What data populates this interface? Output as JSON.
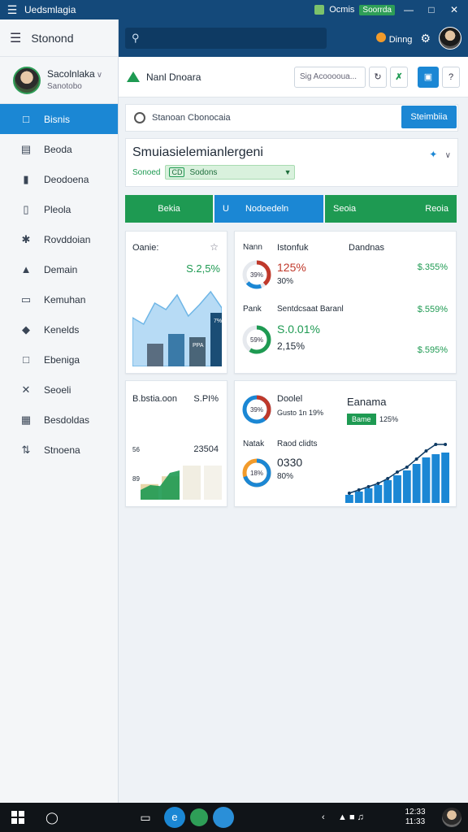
{
  "titlebar": {
    "title": "Uedsmlagia",
    "right_label": "Ocmis",
    "chip": "Soorrda",
    "controls": [
      "—",
      "□",
      "✕"
    ]
  },
  "sidebar": {
    "header": "Stonond",
    "user": {
      "name": "Sacolnlaka",
      "sub": "Sanotobo"
    },
    "items": [
      {
        "label": "Bisnis",
        "icon": "chart-icon",
        "active": true
      },
      {
        "label": "Beoda",
        "icon": "monitor-icon"
      },
      {
        "label": "Deodoena",
        "icon": "lock-icon"
      },
      {
        "label": "Pleola",
        "icon": "document-icon"
      },
      {
        "label": "Rovddoian",
        "icon": "wrench-icon"
      },
      {
        "label": "Demain",
        "icon": "bag-icon"
      },
      {
        "label": "Kemuhan",
        "icon": "folder-icon"
      },
      {
        "label": "Kenelds",
        "icon": "drop-icon"
      },
      {
        "label": "Ebeniga",
        "icon": "copy-icon"
      },
      {
        "label": "Seoeli",
        "icon": "tools-icon"
      },
      {
        "label": "Besdoldas",
        "icon": "calendar-icon"
      },
      {
        "label": "Stnoena",
        "icon": "share-icon"
      }
    ]
  },
  "topbar": {
    "search_placeholder": "",
    "coin_label": "Dinng"
  },
  "page": {
    "title": "Nanl Dnoara",
    "search_value": "Sig Acooooua...",
    "toolbar_label": "Stanoan Cbonocaia",
    "toolbar_button": "Steimbiia",
    "hero_title": "Smuiasielemianlergeni",
    "hero_sub_label": "Sonoed",
    "filter_chip": "CD",
    "filter_value": "Sodons"
  },
  "tabs": {
    "t1": "Bekia",
    "t2_left": "U",
    "t2_right": "Nodoedeln",
    "t3_left": "Seoia",
    "t3_right": "Reoia"
  },
  "card1": {
    "title": "Oanie:",
    "value": "S.2,5%",
    "bar_label": "PPA",
    "bar_label2": "7%",
    "chart_data": {
      "type": "area",
      "area_values": [
        60,
        52,
        78,
        70,
        88,
        62,
        76,
        92,
        72
      ],
      "bars": [
        {
          "value": 28,
          "color": "#5a6d80"
        },
        {
          "value": 40,
          "color": "#3a7aa8"
        },
        {
          "value": 36,
          "color": "#4a6578"
        },
        {
          "value": 66,
          "color": "#1a4d75"
        }
      ],
      "ylim": [
        0,
        100
      ]
    }
  },
  "card2": {
    "h1": "Nann",
    "h2": "Istonfuk",
    "h3": "Dandnas",
    "row1_donut": "39%",
    "row1_value": "125%",
    "row1_sub": "30%",
    "row1_right": "$.355%",
    "mid_left": "Pank",
    "mid_mid": "Sentdcsaat Baranl",
    "mid_right": "$.559%",
    "row2_donut": "59%",
    "row2_value": "S.0.01%",
    "row2_sub": "2,15%",
    "row2_right": "$.595%",
    "donut1_fraction": 0.39,
    "donut2_fraction": 0.59
  },
  "card3": {
    "title": "B.bstia.oon",
    "value": "S.PI%",
    "y1": "56",
    "y2": "89",
    "annot": "23504",
    "chart_data": {
      "type": "area",
      "bars": [
        {
          "value": 32,
          "color": "#e8d6a9"
        },
        {
          "value": 48,
          "color": "#e6d8b0"
        },
        {
          "value": 70,
          "color": "#f1eee2"
        },
        {
          "value": 70,
          "color": "#f4f2ea"
        }
      ],
      "area_values": [
        20,
        30,
        28,
        55,
        60
      ],
      "ylim": [
        0,
        100
      ]
    }
  },
  "card4": {
    "h1": "Doolel",
    "h1_sub": "Gusto 1n 19%",
    "h2": "Eanama",
    "badge": "Bame",
    "badge_value": "125%",
    "r2_left": "Natak",
    "r2_mid": "Raod clidts",
    "big_value": "0330",
    "big_sub": "80%",
    "donut1": "39%",
    "donut2": "18%",
    "donut1_fraction": 0.39,
    "donut2_fraction": 0.7,
    "chart_data": {
      "type": "bar",
      "values": [
        10,
        14,
        18,
        22,
        28,
        34,
        40,
        48,
        56,
        60,
        62
      ],
      "line": [
        12,
        16,
        20,
        24,
        30,
        38,
        44,
        54,
        64,
        72,
        72
      ],
      "ylim": [
        0,
        80
      ]
    }
  },
  "taskbar": {
    "time": "12:33",
    "date": "11:33"
  }
}
